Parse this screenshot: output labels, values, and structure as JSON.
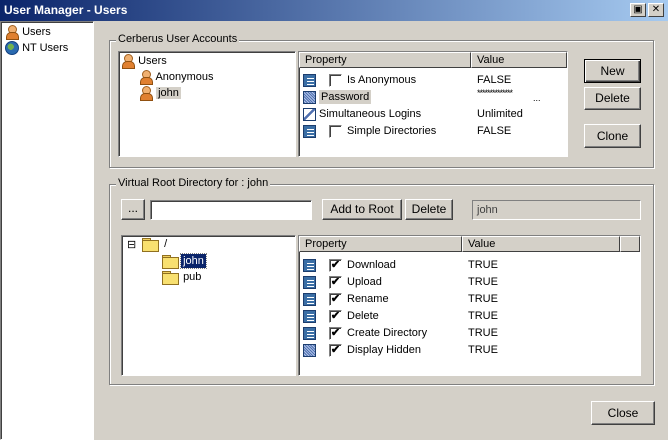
{
  "window": {
    "title": "User Manager - Users"
  },
  "left_tree": {
    "items": [
      {
        "label": "Users",
        "icon": "users-icon"
      },
      {
        "label": "NT Users",
        "icon": "globe-icon"
      }
    ]
  },
  "accounts": {
    "group_title": "Cerberus User Accounts",
    "tree": {
      "root": "Users",
      "children": [
        "Anonymous",
        "john"
      ],
      "selected": "john"
    },
    "table": {
      "headers": [
        "Property",
        "Value"
      ],
      "rows": [
        {
          "property": "Is Anonymous",
          "value": "FALSE",
          "checkbox": true,
          "checked": false,
          "icon": "property-icon"
        },
        {
          "property": "Password",
          "value": "**************",
          "checkbox": false,
          "icon": "password-icon",
          "highlighted": true
        },
        {
          "property": "Simultaneous Logins",
          "value": "Unlimited",
          "checkbox": false,
          "icon": "logins-icon"
        },
        {
          "property": "Simple Directories",
          "value": "FALSE",
          "checkbox": true,
          "checked": false,
          "icon": "property-icon"
        }
      ],
      "password_more": "..."
    },
    "buttons": {
      "new": "New",
      "delete": "Delete",
      "clone": "Clone"
    }
  },
  "vroot": {
    "group_title": "Virtual Root Directory for : john",
    "browse_label": "...",
    "path_value": "",
    "add_label": "Add to Root",
    "delete_label": "Delete",
    "selected_name": "john",
    "tree": {
      "root": "/",
      "expander": "⊟",
      "children": [
        "john",
        "pub"
      ],
      "selected": "john"
    },
    "table": {
      "headers": [
        "Property",
        "Value"
      ],
      "rows": [
        {
          "property": "Download",
          "value": "TRUE",
          "checked": true
        },
        {
          "property": "Upload",
          "value": "TRUE",
          "checked": true
        },
        {
          "property": "Rename",
          "value": "TRUE",
          "checked": true
        },
        {
          "property": "Delete",
          "value": "TRUE",
          "checked": true
        },
        {
          "property": "Create Directory",
          "value": "TRUE",
          "checked": true
        },
        {
          "property": "Display Hidden",
          "value": "TRUE",
          "checked": true
        }
      ]
    }
  },
  "close_label": "Close",
  "check_glyph": "✔",
  "restore_glyph": "▣",
  "close_glyph": "✕"
}
